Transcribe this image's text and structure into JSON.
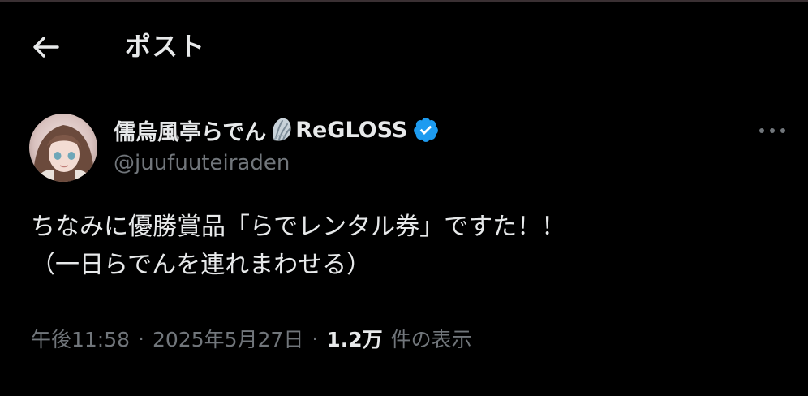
{
  "header": {
    "title": "ポスト",
    "back_icon": "arrow-left-icon"
  },
  "post": {
    "author": {
      "display_name": "儒烏風亭らでん",
      "name_emoji": "shell-icon",
      "affiliation": "ReGLOSS",
      "handle": "@juufuuteiraden",
      "verified": true
    },
    "text_lines": [
      "ちなみに優勝賞品「らでレンタル券」ですた！！",
      "（一日らでんを連れまわせる）"
    ],
    "time": "午後11:58",
    "separator": "·",
    "date": "2025年5月27日",
    "views_count": "1.2万",
    "views_label": "件の表示"
  },
  "colors": {
    "background": "#000000",
    "text_primary": "#e7e9ea",
    "text_secondary": "#71767b",
    "verified_badge": "#1d9bf0",
    "divider": "#2f3336"
  }
}
